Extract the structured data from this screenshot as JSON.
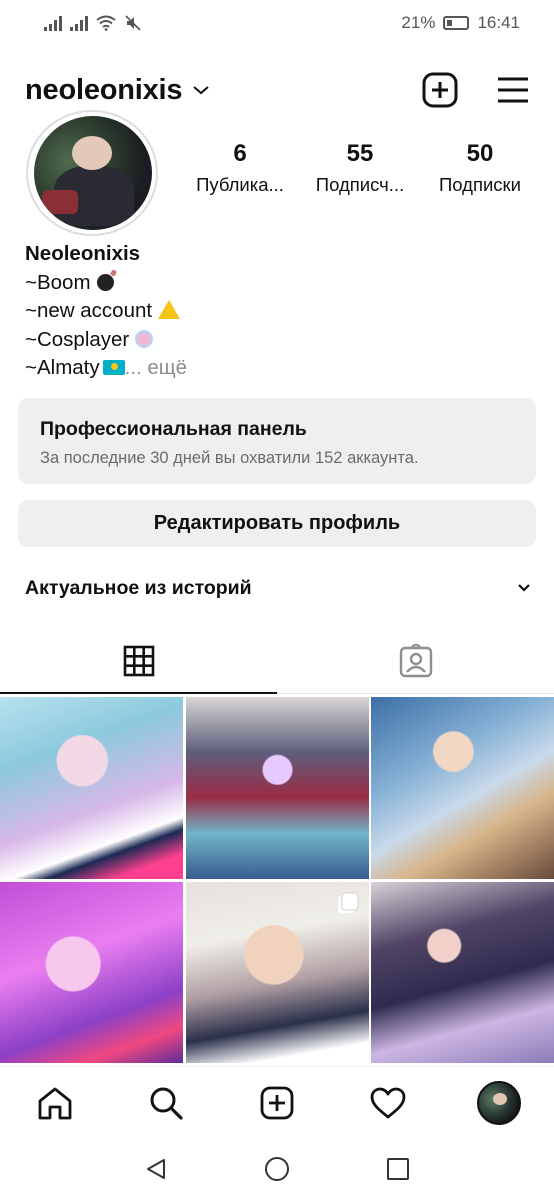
{
  "status_bar": {
    "battery_percent": "21%",
    "time": "16:41"
  },
  "header": {
    "username": "neoleonixis"
  },
  "profile": {
    "stats": [
      {
        "value": "6",
        "label": "Публика..."
      },
      {
        "value": "55",
        "label": "Подписч..."
      },
      {
        "value": "50",
        "label": "Подписки"
      }
    ],
    "display_name": "Neoleonixis",
    "bio_lines": [
      "~Boom",
      "~new account",
      "~Cosplayer",
      "~Almaty"
    ],
    "more_label": "... ещё"
  },
  "pro_panel": {
    "title": "Профессиональная панель",
    "subtitle": "За последние 30 дней вы охватили 152 аккаунта."
  },
  "edit_profile_label": "Редактировать профиль",
  "highlights_label": "Актуальное из историй",
  "tabs": [
    {
      "name": "grid",
      "icon": "grid-icon",
      "active": true
    },
    {
      "name": "tagged",
      "icon": "tagged-person-icon",
      "active": false
    }
  ],
  "posts": [
    {
      "icon_overlay": null
    },
    {
      "icon_overlay": null
    },
    {
      "icon_overlay": null
    },
    {
      "icon_overlay": null
    },
    {
      "icon_overlay": "multiple-posts-icon"
    },
    {
      "icon_overlay": null
    }
  ],
  "bottom_nav": [
    "home-icon",
    "search-icon",
    "create-icon",
    "heart-icon",
    "profile-avatar"
  ],
  "system_nav": [
    "back-icon",
    "home-circle-icon",
    "recents-icon"
  ]
}
